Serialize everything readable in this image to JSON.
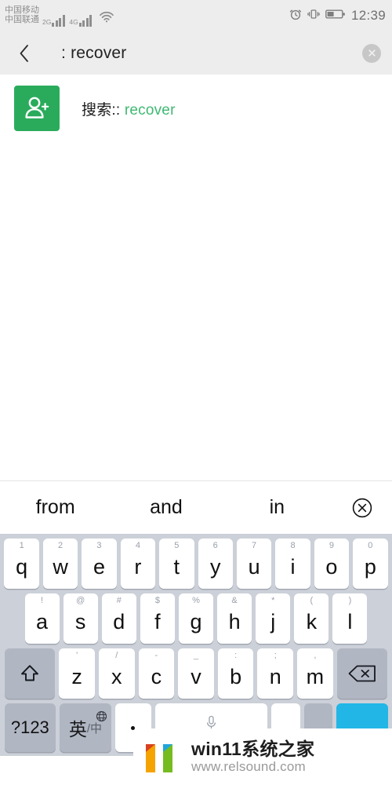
{
  "statusbar": {
    "carrier_primary": "中国移动",
    "carrier_secondary": "中国联通",
    "network_primary": "2G",
    "network_secondary": "4G",
    "icons": [
      "alarm-icon",
      "vibrate-icon",
      "battery-icon",
      "wifi-icon"
    ],
    "time": "12:39"
  },
  "searchbar": {
    "back_label": "‹",
    "query": ": recover",
    "clear_label": "✕"
  },
  "content": {
    "result": {
      "avatar_icon": "add-contact-icon",
      "prefix": "搜索::",
      "keyword": "recover",
      "accent_color": "#3fb973",
      "avatar_color": "#2aab5c"
    }
  },
  "suggestions": {
    "items": [
      "from",
      "and",
      "in"
    ],
    "close_label": "⊗"
  },
  "keyboard": {
    "accent_color": "#22b6e6",
    "bg_color": "#ccd0d8",
    "row1": [
      {
        "hint": "1",
        "main": "q"
      },
      {
        "hint": "2",
        "main": "w"
      },
      {
        "hint": "3",
        "main": "e"
      },
      {
        "hint": "4",
        "main": "r"
      },
      {
        "hint": "5",
        "main": "t"
      },
      {
        "hint": "6",
        "main": "y"
      },
      {
        "hint": "7",
        "main": "u"
      },
      {
        "hint": "8",
        "main": "i"
      },
      {
        "hint": "9",
        "main": "o"
      },
      {
        "hint": "0",
        "main": "p"
      }
    ],
    "row2": [
      {
        "hint": "!",
        "main": "a"
      },
      {
        "hint": "@",
        "main": "s"
      },
      {
        "hint": "#",
        "main": "d"
      },
      {
        "hint": "$",
        "main": "f"
      },
      {
        "hint": "%",
        "main": "g"
      },
      {
        "hint": "&",
        "main": "h"
      },
      {
        "hint": "*",
        "main": "j"
      },
      {
        "hint": "(",
        "main": "k"
      },
      {
        "hint": ")",
        "main": "l"
      }
    ],
    "row3": [
      {
        "hint": "'",
        "main": "z"
      },
      {
        "hint": "/",
        "main": "x"
      },
      {
        "hint": "-",
        "main": "c"
      },
      {
        "hint": "_",
        "main": "v"
      },
      {
        "hint": ":",
        "main": "b"
      },
      {
        "hint": ";",
        "main": "n"
      },
      {
        "hint": ",",
        "main": "m"
      }
    ],
    "shift_label": "shift-icon",
    "backspace_label": "backspace-icon",
    "symbols_label": "?123",
    "lang_main": "英",
    "lang_sub": "/中",
    "period_label": ".",
    "space_label": "space-bar",
    "slash_label": "",
    "comma_label": "",
    "enter_label": ""
  },
  "watermark": {
    "title": "win11系统之家",
    "url": "www.relsound.com",
    "logo_colors": [
      "#d8411f",
      "#f5a300",
      "#1fa5e0",
      "#76bc21"
    ]
  }
}
